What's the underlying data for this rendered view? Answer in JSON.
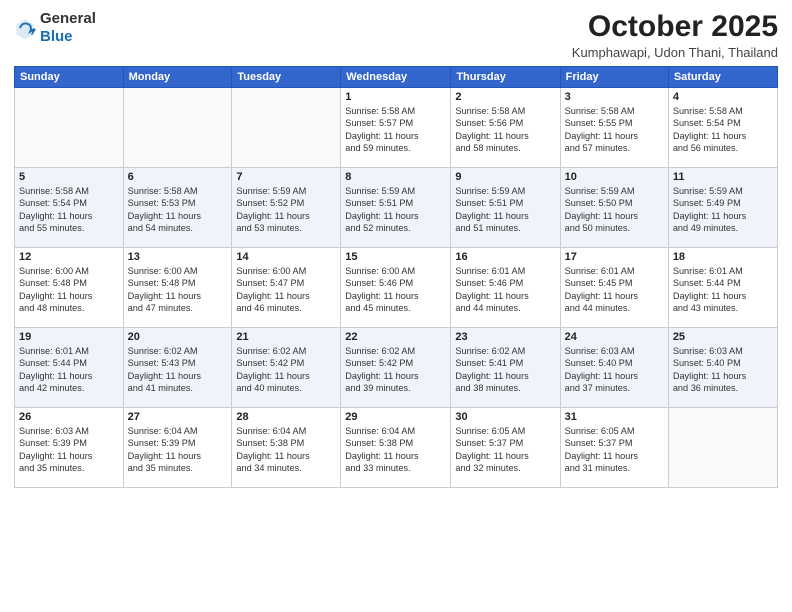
{
  "header": {
    "logo_general": "General",
    "logo_blue": "Blue",
    "month_title": "October 2025",
    "location": "Kumphawapi, Udon Thani, Thailand"
  },
  "days_of_week": [
    "Sunday",
    "Monday",
    "Tuesday",
    "Wednesday",
    "Thursday",
    "Friday",
    "Saturday"
  ],
  "weeks": [
    [
      {
        "day": "",
        "info": ""
      },
      {
        "day": "",
        "info": ""
      },
      {
        "day": "",
        "info": ""
      },
      {
        "day": "1",
        "info": "Sunrise: 5:58 AM\nSunset: 5:57 PM\nDaylight: 11 hours\nand 59 minutes."
      },
      {
        "day": "2",
        "info": "Sunrise: 5:58 AM\nSunset: 5:56 PM\nDaylight: 11 hours\nand 58 minutes."
      },
      {
        "day": "3",
        "info": "Sunrise: 5:58 AM\nSunset: 5:55 PM\nDaylight: 11 hours\nand 57 minutes."
      },
      {
        "day": "4",
        "info": "Sunrise: 5:58 AM\nSunset: 5:54 PM\nDaylight: 11 hours\nand 56 minutes."
      }
    ],
    [
      {
        "day": "5",
        "info": "Sunrise: 5:58 AM\nSunset: 5:54 PM\nDaylight: 11 hours\nand 55 minutes."
      },
      {
        "day": "6",
        "info": "Sunrise: 5:58 AM\nSunset: 5:53 PM\nDaylight: 11 hours\nand 54 minutes."
      },
      {
        "day": "7",
        "info": "Sunrise: 5:59 AM\nSunset: 5:52 PM\nDaylight: 11 hours\nand 53 minutes."
      },
      {
        "day": "8",
        "info": "Sunrise: 5:59 AM\nSunset: 5:51 PM\nDaylight: 11 hours\nand 52 minutes."
      },
      {
        "day": "9",
        "info": "Sunrise: 5:59 AM\nSunset: 5:51 PM\nDaylight: 11 hours\nand 51 minutes."
      },
      {
        "day": "10",
        "info": "Sunrise: 5:59 AM\nSunset: 5:50 PM\nDaylight: 11 hours\nand 50 minutes."
      },
      {
        "day": "11",
        "info": "Sunrise: 5:59 AM\nSunset: 5:49 PM\nDaylight: 11 hours\nand 49 minutes."
      }
    ],
    [
      {
        "day": "12",
        "info": "Sunrise: 6:00 AM\nSunset: 5:48 PM\nDaylight: 11 hours\nand 48 minutes."
      },
      {
        "day": "13",
        "info": "Sunrise: 6:00 AM\nSunset: 5:48 PM\nDaylight: 11 hours\nand 47 minutes."
      },
      {
        "day": "14",
        "info": "Sunrise: 6:00 AM\nSunset: 5:47 PM\nDaylight: 11 hours\nand 46 minutes."
      },
      {
        "day": "15",
        "info": "Sunrise: 6:00 AM\nSunset: 5:46 PM\nDaylight: 11 hours\nand 45 minutes."
      },
      {
        "day": "16",
        "info": "Sunrise: 6:01 AM\nSunset: 5:46 PM\nDaylight: 11 hours\nand 44 minutes."
      },
      {
        "day": "17",
        "info": "Sunrise: 6:01 AM\nSunset: 5:45 PM\nDaylight: 11 hours\nand 44 minutes."
      },
      {
        "day": "18",
        "info": "Sunrise: 6:01 AM\nSunset: 5:44 PM\nDaylight: 11 hours\nand 43 minutes."
      }
    ],
    [
      {
        "day": "19",
        "info": "Sunrise: 6:01 AM\nSunset: 5:44 PM\nDaylight: 11 hours\nand 42 minutes."
      },
      {
        "day": "20",
        "info": "Sunrise: 6:02 AM\nSunset: 5:43 PM\nDaylight: 11 hours\nand 41 minutes."
      },
      {
        "day": "21",
        "info": "Sunrise: 6:02 AM\nSunset: 5:42 PM\nDaylight: 11 hours\nand 40 minutes."
      },
      {
        "day": "22",
        "info": "Sunrise: 6:02 AM\nSunset: 5:42 PM\nDaylight: 11 hours\nand 39 minutes."
      },
      {
        "day": "23",
        "info": "Sunrise: 6:02 AM\nSunset: 5:41 PM\nDaylight: 11 hours\nand 38 minutes."
      },
      {
        "day": "24",
        "info": "Sunrise: 6:03 AM\nSunset: 5:40 PM\nDaylight: 11 hours\nand 37 minutes."
      },
      {
        "day": "25",
        "info": "Sunrise: 6:03 AM\nSunset: 5:40 PM\nDaylight: 11 hours\nand 36 minutes."
      }
    ],
    [
      {
        "day": "26",
        "info": "Sunrise: 6:03 AM\nSunset: 5:39 PM\nDaylight: 11 hours\nand 35 minutes."
      },
      {
        "day": "27",
        "info": "Sunrise: 6:04 AM\nSunset: 5:39 PM\nDaylight: 11 hours\nand 35 minutes."
      },
      {
        "day": "28",
        "info": "Sunrise: 6:04 AM\nSunset: 5:38 PM\nDaylight: 11 hours\nand 34 minutes."
      },
      {
        "day": "29",
        "info": "Sunrise: 6:04 AM\nSunset: 5:38 PM\nDaylight: 11 hours\nand 33 minutes."
      },
      {
        "day": "30",
        "info": "Sunrise: 6:05 AM\nSunset: 5:37 PM\nDaylight: 11 hours\nand 32 minutes."
      },
      {
        "day": "31",
        "info": "Sunrise: 6:05 AM\nSunset: 5:37 PM\nDaylight: 11 hours\nand 31 minutes."
      },
      {
        "day": "",
        "info": ""
      }
    ]
  ]
}
